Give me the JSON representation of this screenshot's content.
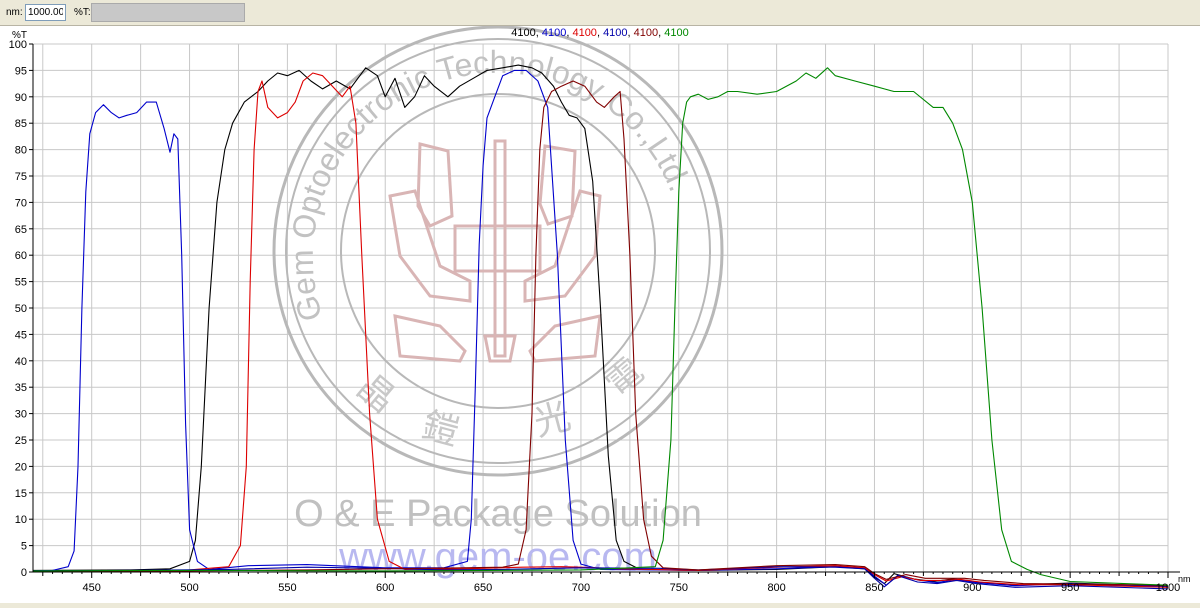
{
  "toolbar": {
    "nm_label": "nm:",
    "nm_value": "1000.00",
    "t_label": "%T:",
    "t_value": ""
  },
  "chart_data": {
    "type": "line",
    "ylabel": "%T",
    "xlabel": "nm",
    "xlim": [
      420,
      1000
    ],
    "ylim": [
      0,
      100
    ],
    "x_ticks": [
      450,
      500,
      550,
      600,
      650,
      700,
      750,
      800,
      850,
      900,
      950,
      1000
    ],
    "y_ticks": [
      0,
      5,
      10,
      15,
      20,
      25,
      30,
      35,
      40,
      45,
      50,
      55,
      60,
      65,
      70,
      75,
      80,
      85,
      90,
      95,
      100
    ],
    "grid": true,
    "legend_position": "top-center",
    "watermark": {
      "seal_text": "Gem Optoelectronic Technology Co.,Ltd.",
      "chinese_chars": [
        "晶",
        "鎧",
        "光",
        "電"
      ],
      "package_text": "O & E Package Solution",
      "url_text": "www.gem-oe.com"
    },
    "series": [
      {
        "name": "4100",
        "color": "#000000",
        "points": [
          [
            420,
            0.3
          ],
          [
            470,
            0.4
          ],
          [
            490,
            0.6
          ],
          [
            500,
            2
          ],
          [
            503,
            6
          ],
          [
            506,
            20
          ],
          [
            510,
            50
          ],
          [
            514,
            70
          ],
          [
            518,
            80
          ],
          [
            522,
            85
          ],
          [
            528,
            89
          ],
          [
            535,
            91
          ],
          [
            540,
            93
          ],
          [
            545,
            94.5
          ],
          [
            550,
            94
          ],
          [
            556,
            95
          ],
          [
            562,
            93
          ],
          [
            568,
            91.5
          ],
          [
            575,
            93
          ],
          [
            582,
            91.5
          ],
          [
            590,
            95.5
          ],
          [
            596,
            94
          ],
          [
            600,
            90
          ],
          [
            605,
            93.5
          ],
          [
            610,
            88
          ],
          [
            615,
            90
          ],
          [
            620,
            94
          ],
          [
            625,
            92
          ],
          [
            632,
            90
          ],
          [
            638,
            92
          ],
          [
            645,
            93.5
          ],
          [
            652,
            95
          ],
          [
            660,
            95.5
          ],
          [
            668,
            96
          ],
          [
            675,
            95.5
          ],
          [
            680,
            94.5
          ],
          [
            686,
            92
          ],
          [
            690,
            89
          ],
          [
            694,
            86.5
          ],
          [
            698,
            86
          ],
          [
            702,
            84
          ],
          [
            706,
            74
          ],
          [
            710,
            50
          ],
          [
            714,
            22
          ],
          [
            718,
            6
          ],
          [
            722,
            2
          ],
          [
            730,
            0.5
          ],
          [
            760,
            0.3
          ],
          [
            800,
            0.5
          ],
          [
            830,
            1
          ],
          [
            845,
            0.6
          ],
          [
            850,
            -1
          ],
          [
            855,
            -2.2
          ],
          [
            860,
            -0.3
          ],
          [
            870,
            -1.3
          ],
          [
            880,
            -1.8
          ],
          [
            890,
            -1.3
          ],
          [
            900,
            -1.8
          ],
          [
            920,
            -2.5
          ],
          [
            950,
            -2.1
          ],
          [
            1000,
            -2.7
          ]
        ]
      },
      {
        "name": "4100",
        "color": "#0000cc",
        "points": [
          [
            420,
            0.2
          ],
          [
            430,
            0.3
          ],
          [
            438,
            1
          ],
          [
            441,
            4
          ],
          [
            443,
            20
          ],
          [
            445,
            50
          ],
          [
            447,
            72
          ],
          [
            449,
            83
          ],
          [
            452,
            87
          ],
          [
            456,
            88.5
          ],
          [
            460,
            87
          ],
          [
            464,
            86
          ],
          [
            468,
            86.5
          ],
          [
            473,
            87
          ],
          [
            478,
            89
          ],
          [
            483,
            89
          ],
          [
            487,
            84
          ],
          [
            490,
            79.5
          ],
          [
            492,
            83
          ],
          [
            494,
            82
          ],
          [
            496,
            60
          ],
          [
            498,
            28
          ],
          [
            500,
            8
          ],
          [
            504,
            2
          ],
          [
            510,
            0.5
          ],
          [
            530,
            1.2
          ],
          [
            560,
            1.4
          ],
          [
            600,
            0.8
          ],
          [
            630,
            0.8
          ],
          [
            642,
            2
          ],
          [
            644,
            10
          ],
          [
            646,
            35
          ],
          [
            648,
            62
          ],
          [
            650,
            77
          ],
          [
            652,
            86
          ],
          [
            656,
            90
          ],
          [
            660,
            94
          ],
          [
            666,
            95
          ],
          [
            672,
            95
          ],
          [
            678,
            93
          ],
          [
            683,
            88
          ],
          [
            688,
            60
          ],
          [
            692,
            25
          ],
          [
            696,
            6
          ],
          [
            700,
            1.5
          ],
          [
            710,
            0.5
          ],
          [
            760,
            0.3
          ],
          [
            800,
            0.6
          ],
          [
            830,
            1
          ],
          [
            845,
            0.8
          ],
          [
            850,
            -0.8
          ],
          [
            856,
            -2.5
          ],
          [
            862,
            -0.6
          ],
          [
            872,
            -1.5
          ],
          [
            882,
            -2
          ],
          [
            892,
            -1.4
          ],
          [
            902,
            -2
          ],
          [
            922,
            -2.6
          ],
          [
            950,
            -2.2
          ],
          [
            1000,
            -2.8
          ]
        ]
      },
      {
        "name": "4100",
        "color": "#dd0000",
        "points": [
          [
            420,
            0.1
          ],
          [
            470,
            0.2
          ],
          [
            500,
            0.4
          ],
          [
            520,
            1
          ],
          [
            526,
            5
          ],
          [
            529,
            20
          ],
          [
            531,
            55
          ],
          [
            533,
            80
          ],
          [
            535,
            91
          ],
          [
            537,
            93
          ],
          [
            540,
            88
          ],
          [
            545,
            86
          ],
          [
            550,
            87
          ],
          [
            554,
            89
          ],
          [
            558,
            93
          ],
          [
            563,
            94.5
          ],
          [
            568,
            94
          ],
          [
            573,
            92
          ],
          [
            578,
            90
          ],
          [
            582,
            92
          ],
          [
            585,
            85
          ],
          [
            588,
            60
          ],
          [
            592,
            30
          ],
          [
            596,
            10
          ],
          [
            602,
            2
          ],
          [
            610,
            0.5
          ],
          [
            640,
            0.6
          ],
          [
            670,
            0.9
          ],
          [
            690,
            1
          ],
          [
            700,
            0.9
          ],
          [
            720,
            0.6
          ],
          [
            760,
            0.3
          ],
          [
            800,
            0.9
          ],
          [
            830,
            1.2
          ],
          [
            845,
            0.8
          ],
          [
            850,
            -0.5
          ],
          [
            856,
            -1.7
          ],
          [
            864,
            -0.9
          ],
          [
            874,
            -1.6
          ],
          [
            884,
            -1.6
          ],
          [
            894,
            -1.4
          ],
          [
            904,
            -1.9
          ],
          [
            924,
            -2.4
          ],
          [
            950,
            -2.4
          ],
          [
            1000,
            -2.9
          ]
        ]
      },
      {
        "name": "4100",
        "color": "#0000aa",
        "points": [
          [
            420,
            0.2
          ],
          [
            470,
            0.3
          ],
          [
            520,
            0.5
          ],
          [
            560,
            0.9
          ],
          [
            600,
            0.7
          ],
          [
            630,
            0.4
          ],
          [
            660,
            0.5
          ],
          [
            700,
            0.8
          ],
          [
            740,
            0.7
          ],
          [
            760,
            0.4
          ],
          [
            800,
            1
          ],
          [
            830,
            0.9
          ],
          [
            845,
            0.6
          ],
          [
            850,
            -1.2
          ],
          [
            855,
            -2.8
          ],
          [
            862,
            -0.7
          ],
          [
            872,
            -1.9
          ],
          [
            882,
            -2.2
          ],
          [
            892,
            -1.6
          ],
          [
            902,
            -2.2
          ],
          [
            922,
            -2.9
          ],
          [
            950,
            -2.6
          ],
          [
            1000,
            -3.2
          ]
        ]
      },
      {
        "name": "4100",
        "color": "#800000",
        "points": [
          [
            420,
            0.1
          ],
          [
            500,
            0.2
          ],
          [
            560,
            0.4
          ],
          [
            600,
            0.6
          ],
          [
            640,
            0.8
          ],
          [
            660,
            0.9
          ],
          [
            668,
            1.5
          ],
          [
            672,
            8
          ],
          [
            675,
            30
          ],
          [
            677,
            60
          ],
          [
            679,
            80
          ],
          [
            681,
            88
          ],
          [
            685,
            91
          ],
          [
            690,
            92
          ],
          [
            696,
            93
          ],
          [
            702,
            92
          ],
          [
            708,
            89
          ],
          [
            712,
            88
          ],
          [
            717,
            90
          ],
          [
            720,
            91
          ],
          [
            722,
            82
          ],
          [
            725,
            60
          ],
          [
            728,
            30
          ],
          [
            732,
            10
          ],
          [
            736,
            3
          ],
          [
            742,
            0.8
          ],
          [
            760,
            0.4
          ],
          [
            800,
            1.2
          ],
          [
            830,
            1.4
          ],
          [
            845,
            1
          ],
          [
            850,
            -0.3
          ],
          [
            856,
            -1.4
          ],
          [
            866,
            -0.5
          ],
          [
            876,
            -1.2
          ],
          [
            886,
            -1.2
          ],
          [
            896,
            -1.2
          ],
          [
            906,
            -1.6
          ],
          [
            926,
            -2.2
          ],
          [
            950,
            -2.3
          ],
          [
            1000,
            -2.5
          ]
        ]
      },
      {
        "name": "4100",
        "color": "#008800",
        "points": [
          [
            420,
            0.2
          ],
          [
            500,
            0.3
          ],
          [
            600,
            0.2
          ],
          [
            700,
            0.4
          ],
          [
            738,
            1
          ],
          [
            742,
            6
          ],
          [
            746,
            25
          ],
          [
            748,
            50
          ],
          [
            750,
            72
          ],
          [
            752,
            85
          ],
          [
            754,
            89
          ],
          [
            756,
            90
          ],
          [
            760,
            90.5
          ],
          [
            765,
            89.5
          ],
          [
            770,
            90
          ],
          [
            775,
            91
          ],
          [
            780,
            91
          ],
          [
            790,
            90.5
          ],
          [
            800,
            91
          ],
          [
            810,
            93
          ],
          [
            815,
            94.5
          ],
          [
            820,
            93.5
          ],
          [
            826,
            95.5
          ],
          [
            830,
            94
          ],
          [
            840,
            93
          ],
          [
            850,
            92
          ],
          [
            855,
            91.5
          ],
          [
            860,
            91
          ],
          [
            870,
            91
          ],
          [
            880,
            88
          ],
          [
            885,
            88
          ],
          [
            890,
            85
          ],
          [
            895,
            80
          ],
          [
            900,
            70
          ],
          [
            905,
            50
          ],
          [
            910,
            25
          ],
          [
            915,
            8
          ],
          [
            920,
            2
          ],
          [
            928,
            0.5
          ],
          [
            935,
            -0.5
          ],
          [
            950,
            -1.8
          ],
          [
            1000,
            -2.5
          ]
        ]
      }
    ]
  }
}
